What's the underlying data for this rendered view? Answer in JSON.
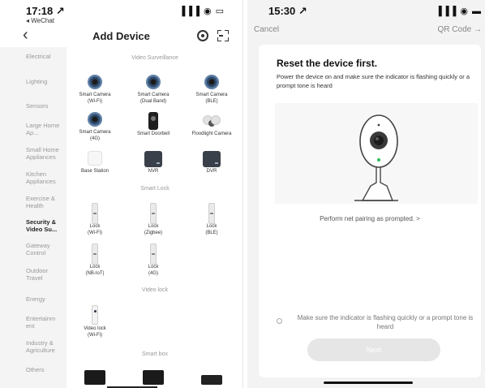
{
  "left": {
    "status": {
      "time": "17:18 ↗",
      "back_app": "◂ WeChat",
      "indicators": "▐▐▐ ◉ ▭"
    },
    "nav": {
      "back": "‹",
      "title": "Add Device",
      "icon_left": "device-scan-icon",
      "icon_right": "qr-scan-icon"
    },
    "sidebar": [
      "Electrical",
      "Lighting",
      "Sensors",
      "Large Home Ap...",
      "Small Home Appliances",
      "Kitchen Appliances",
      "Exercise & Health",
      "Security & Video Su...",
      "Gateway Control",
      "Outdoor Travel",
      "Energy",
      "Entertainm ent",
      "Industry & Agriculture",
      "Others"
    ],
    "sidebar_active_index": 7,
    "sections": {
      "video": "Video Surveillance",
      "lock": "Smart Lock",
      "vlock": "Video lock",
      "box": "Smart box"
    },
    "devices": {
      "cam_wifi": "Smart Camera\n(Wi-Fi)",
      "cam_dual": "Smart Camera\n(Dual Band)",
      "cam_ble": "Smart Camera\n(BLE)",
      "cam_4g": "Smart Camera\n(4G)",
      "doorbell": "Smart Doorbell",
      "flood": "Floodlight Camera",
      "base": "Base Station",
      "nvr": "NVR",
      "dvr": "DVR",
      "lock_wifi": "Lock\n(Wi-Fi)",
      "lock_zigbee": "Lock\n(Zigbee)",
      "lock_ble": "Lock\n(BLE)",
      "lock_nb": "Lock\n(NB-IoT)",
      "lock_4g": "Lock\n(4G)",
      "vlock_wifi": "Video lock\n(Wi-Fi)"
    }
  },
  "right": {
    "status": {
      "time": "15:30 ↗",
      "indicators": "▐▐▐ ◉ ▬"
    },
    "nav": {
      "cancel": "Cancel",
      "qr": "QR Code →"
    },
    "card": {
      "heading": "Reset the device first.",
      "desc": "Power the device on and make sure the indicator is flashing quickly or a prompt tone is heard",
      "link": "Perform net pairing as prompted. >",
      "confirm": "Make sure the indicator is flashing quickly or a prompt tone is heard",
      "next": "Next"
    }
  }
}
